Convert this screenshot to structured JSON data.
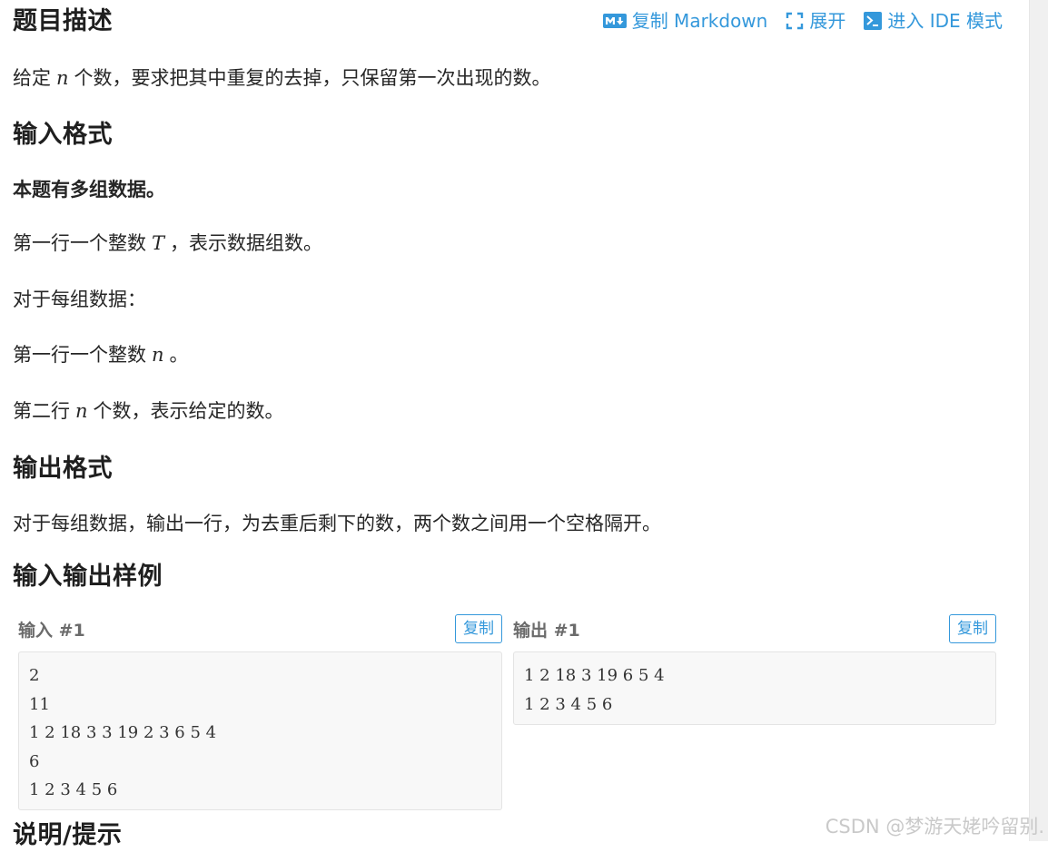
{
  "toolbar": {
    "copy_markdown": "复制 Markdown",
    "expand": "展开",
    "ide_mode": "进入 IDE 模式"
  },
  "sections": {
    "description_title": "题目描述",
    "description_text_before": "给定",
    "description_var": "n",
    "description_text_after": "个数，要求把其中重复的去掉，只保留第一次出现的数。",
    "input_title": "输入格式",
    "input_multi": "本题有多组数据。",
    "input_line1_before": "第一行一个整数",
    "input_line1_var": "T",
    "input_line1_after": "，表示数据组数。",
    "input_each": "对于每组数据：",
    "input_line2_before": "第一行一个整数",
    "input_line2_var": "n",
    "input_line2_after": "。",
    "input_line3_before": "第二行",
    "input_line3_var": "n",
    "input_line3_after": "个数，表示给定的数。",
    "output_title": "输出格式",
    "output_text": "对于每组数据，输出一行，为去重后剩下的数，两个数之间用一个空格隔开。",
    "samples_title": "输入输出样例",
    "next_title": "说明/提示"
  },
  "samples": {
    "input_label": "输入 #1",
    "output_label": "输出 #1",
    "copy_label": "复制",
    "input_lines": [
      "2",
      "11",
      "1 2 18 3 3 19 2 3 6 5 4",
      "6",
      "1 2 3 4 5 6"
    ],
    "output_lines": [
      "1 2 18 3 19 6 5 4",
      "1 2 3 4 5 6"
    ]
  },
  "watermark": "CSDN @梦游天姥吟留别.",
  "colors": {
    "accent": "#3498db",
    "heading": "#1f1f1f",
    "text": "#262626",
    "sample_bg": "#f8f8f8"
  },
  "icons": [
    "markdown-icon",
    "expand-icon",
    "terminal-icon"
  ]
}
